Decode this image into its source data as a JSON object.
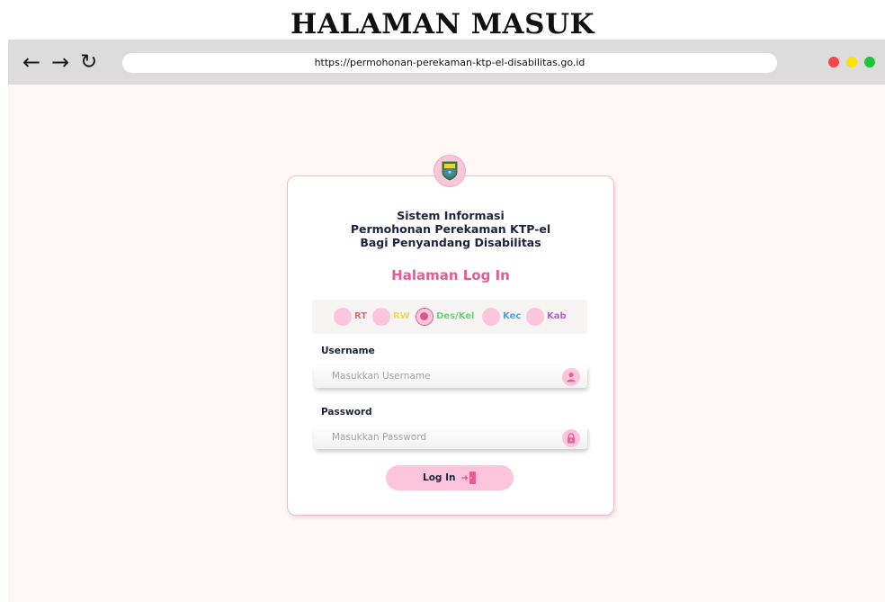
{
  "page_heading": "HALAMAN MASUK",
  "browser": {
    "back_icon": "arrow-left-icon",
    "forward_icon": "arrow-right-icon",
    "reload_icon": "reload-icon",
    "url": "https://permohonan-perekaman-ktp-el-disabilitas.go.id",
    "window_dots": [
      "#f44848",
      "#ffe100",
      "#20c43a"
    ]
  },
  "login": {
    "emblem_icon": "emblem-icon",
    "system_title": [
      "Sistem Informasi",
      "Permohonan Perekaman KTP-el",
      "Bagi Penyandang Disabilitas"
    ],
    "heading": "Halaman Log In",
    "roles": [
      {
        "label": "RT",
        "color": "#f26363",
        "selected": false
      },
      {
        "label": "RW",
        "color": "#f5d84a",
        "selected": false
      },
      {
        "label": "Des/Kel",
        "color": "#5ed86c",
        "selected": true
      },
      {
        "label": "Kec",
        "color": "#45a5e8",
        "selected": false
      },
      {
        "label": "Kab",
        "color": "#c25ad8",
        "selected": false
      }
    ],
    "username": {
      "label": "Username",
      "placeholder": "Masukkan Username",
      "icon": "user-icon"
    },
    "password": {
      "label": "Password",
      "placeholder": "Masukkan Password",
      "icon": "lock-icon"
    },
    "submit": {
      "label": "Log In",
      "icon": "door-enter-icon"
    }
  },
  "colors": {
    "accent": "#e65a98",
    "pink_light": "#fcc5db",
    "background": "#fdf7f6",
    "text_dark": "#1d2240"
  }
}
